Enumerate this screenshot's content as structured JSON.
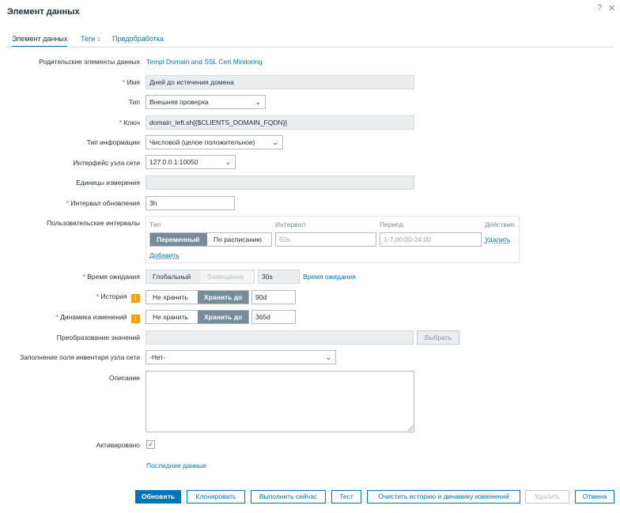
{
  "dialog": {
    "title": "Элемент данных",
    "help_icon": "?",
    "close_icon": "✕"
  },
  "tabs": [
    {
      "label": "Элемент данных"
    },
    {
      "label": "Теги",
      "count": "1"
    },
    {
      "label": "Предобработка"
    }
  ],
  "form": {
    "parent": {
      "label": "Родительские элементы данных",
      "value": "Templ Domain and SSL Cert Minitoring"
    },
    "name": {
      "label": "Имя",
      "value": "Дней до истечения домена"
    },
    "type": {
      "label": "Тип",
      "value": "Внешняя проверка"
    },
    "key": {
      "label": "Ключ",
      "value": "domain_left.sh[{$CLIENTS_DOMAIN_FQDN}]"
    },
    "info_type": {
      "label": "Тип информации",
      "value": "Числовой (целое положительное)"
    },
    "interface": {
      "label": "Интерфейс узла сети",
      "value": "127.0.0.1:10050"
    },
    "units": {
      "label": "Единицы измерения",
      "value": ""
    },
    "update_interval": {
      "label": "Интервал обновления",
      "value": "3h"
    },
    "custom_intervals": {
      "label": "Пользовательские интервалы",
      "columns": [
        "Тип",
        "Интервал",
        "Период",
        "Действие"
      ],
      "row": {
        "type_options": [
          "Переменный",
          "По расписанию"
        ],
        "interval_placeholder": "50s",
        "period_placeholder": "1-7,00:00-24:00",
        "remove_label": "Удалить"
      },
      "add_label": "Добавить"
    },
    "timeout": {
      "label": "Время ожидания",
      "options": [
        "Глобальный",
        "Замещение"
      ],
      "value": "30s",
      "link": "Время ожидания"
    },
    "history": {
      "label": "История",
      "options": [
        "Не хранить",
        "Хранить до"
      ],
      "value": "90d"
    },
    "trends": {
      "label": "Динамика изменений",
      "options": [
        "Не хранить",
        "Хранить до"
      ],
      "value": "365d"
    },
    "valuemap": {
      "label": "Преобразование значений",
      "value": "",
      "button": "Выбрать"
    },
    "inventory": {
      "label": "Заполнение поля инвентаря узла сети",
      "value": "-Нет-"
    },
    "description": {
      "label": "Описание",
      "value": ""
    },
    "enabled": {
      "label": "Активировано",
      "checked": true,
      "check_glyph": "✓"
    },
    "latest_data_link": "Последние данные",
    "required_mark": "*",
    "info_badge": "i"
  },
  "footer": {
    "buttons": [
      "Обновить",
      "Клонировать",
      "Выполнить сейчас",
      "Тест",
      "Очистить историю и динамику изменений",
      "Удалить",
      "Отмена"
    ]
  },
  "colors": {
    "accent": "#0275b8",
    "selected_segment": "#768d99",
    "required": "#e53935",
    "info": "#f0a116"
  }
}
